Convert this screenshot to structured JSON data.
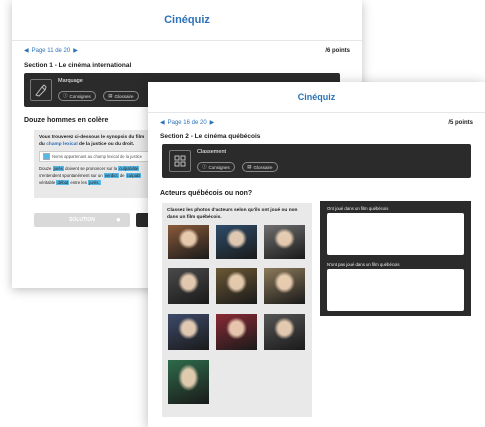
{
  "back_window": {
    "app_title": "Cinéquiz",
    "pager": "Page 11 de 20",
    "points": "/6 points",
    "section": "Section 1 - Le cinéma international",
    "tool": {
      "name": "Marquage",
      "chip1": "Consignes",
      "chip2": "Glossaire"
    },
    "question_title": "Douze hommes en colère",
    "instruction_a": "Vous trouverez ci-dessous le synopsis du film",
    "instruction_link": "champ lexical",
    "instruction_b_prefix": "du",
    "instruction_b_suffix": "de la justice ou du droit.",
    "legend": "Noms appartenant au champ lexical de la justice",
    "synopsis": {
      "l1_a": "Douze",
      "l1_h": "jurés",
      "l1_b": "doivent se prononcer sur la",
      "l1_h2": "culpabilité",
      "l2_a": "s'entendent spontanément sur un",
      "l2_h": "verdict",
      "l2_b": "de",
      "l2_h2": "culpabi",
      "l3_a": "véritable",
      "l3_h": "débat",
      "l3_b": "entre les",
      "l3_h2": "jurés."
    },
    "solution_button": "SOLUTION"
  },
  "front_window": {
    "app_title": "Cinéquiz",
    "pager": "Page 16 de 20",
    "points": "/5 points",
    "section": "Section 2 - Le cinéma québécois",
    "tool": {
      "name": "Classement",
      "chip1": "Consignes",
      "chip2": "Glossaire"
    },
    "question_title": "Acteurs québécois ou non?",
    "instruction": "Classez les photos d'acteurs selon qu'ils ont joué ou non dans un film québécois.",
    "drop_zones": [
      {
        "label": "Ont joué dans un film québécois"
      },
      {
        "label": "N'ont pas joué dans un film québécois"
      }
    ],
    "photos": [
      {
        "name": "photo-actor-1",
        "bg": "#8a5a3a"
      },
      {
        "name": "photo-actor-2",
        "bg": "#2f4d6a"
      },
      {
        "name": "photo-actor-3",
        "bg": "#6f6f6f"
      },
      {
        "name": "photo-actor-4",
        "bg": "#4a4a4a"
      },
      {
        "name": "photo-actor-5",
        "bg": "#6b5836"
      },
      {
        "name": "photo-actor-6",
        "bg": "#8c7a5a"
      },
      {
        "name": "photo-actor-7",
        "bg": "#3d4a6a"
      },
      {
        "name": "photo-actor-8",
        "bg": "#8a2a35"
      },
      {
        "name": "photo-actor-9",
        "bg": "#555555"
      },
      {
        "name": "photo-actor-10",
        "bg": "#2e6b4a"
      }
    ]
  },
  "colors": {
    "accent": "#2b72b8",
    "dark": "#2b2b2b",
    "highlight": "#58b7e4",
    "panel": "#e9e9e9"
  }
}
